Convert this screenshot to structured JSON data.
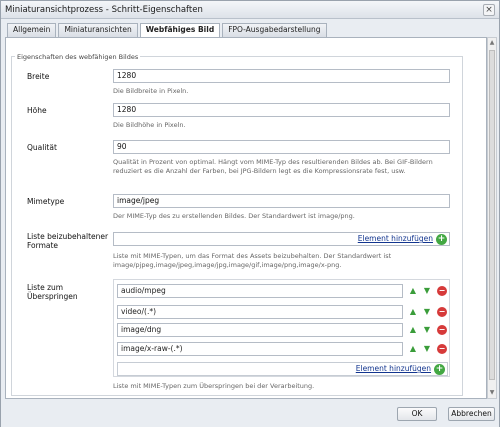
{
  "window": {
    "title": "Miniaturansichtprozess - Schritt-Eigenschaften"
  },
  "tabs": [
    {
      "label": "Allgemein"
    },
    {
      "label": "Miniaturansichten"
    },
    {
      "label": "Webfähiges Bild"
    },
    {
      "label": "FPO-Ausgabedarstellung"
    }
  ],
  "section": {
    "legend": "Eigenschaften des webfähigen Bildes"
  },
  "fields": {
    "width": {
      "label": "Breite",
      "value": "1280",
      "help": "Die Bildbreite in Pixeln."
    },
    "height": {
      "label": "Höhe",
      "value": "1280",
      "help": "Die Bildhöhe in Pixeln."
    },
    "quality": {
      "label": "Qualität",
      "value": "90",
      "help": "Qualität in Prozent von optimal. Hängt vom MIME-Typ des resultierenden Bildes ab. Bei GIF-Bildern reduziert es die Anzahl der Farben, bei JPG-Bildern legt es die Kompressionsrate fest, usw."
    },
    "mimetype": {
      "label": "Mimetype",
      "value": "image/jpeg",
      "help": "Der MIME-Typ des zu erstellenden Bildes. Der Standardwert ist image/png."
    },
    "keep_formats": {
      "label": "Liste beizubehaltener Formate",
      "add_label": "Element hinzufügen",
      "help": "Liste mit MIME-Typen, um das Format des Assets beizubehalten. Der Standardwert ist image/pjpeg,image/jpeg,image/jpg,image/gif,image/png,image/x-png."
    },
    "skip_list": {
      "label": "Liste zum Überspringen",
      "items": [
        "audio/mpeg",
        "video/(.*)",
        "image/dng",
        "image/x-raw-(.*)"
      ],
      "add_label": "Element hinzufügen",
      "help": "Liste mit MIME-Typen zum Überspringen bei der Verarbeitung."
    }
  },
  "buttons": {
    "ok": "OK",
    "cancel": "Abbrechen"
  },
  "icons": {
    "close": "×",
    "add": "+",
    "up": "▲",
    "down": "▼",
    "remove": "−"
  }
}
